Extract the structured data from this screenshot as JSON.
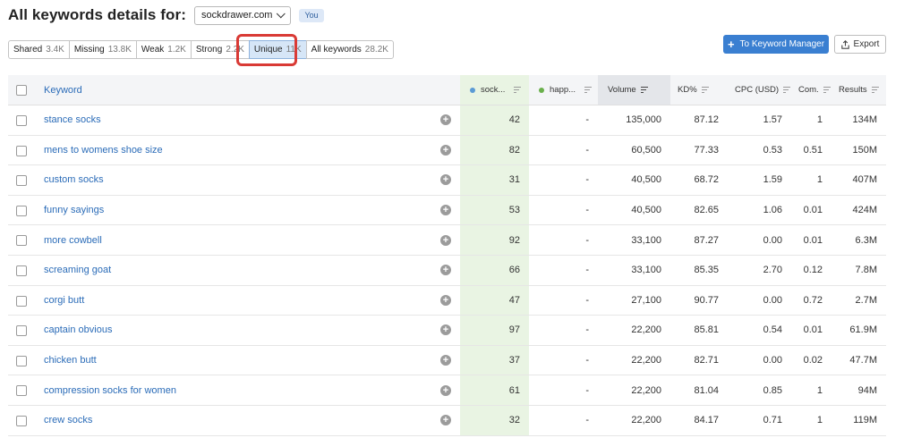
{
  "header": {
    "title": "All keywords details for:",
    "domain": "sockdrawer.com",
    "badge": "You"
  },
  "filters": [
    {
      "label": "Shared",
      "count": "3.4K",
      "active": false
    },
    {
      "label": "Missing",
      "count": "13.8K",
      "active": false
    },
    {
      "label": "Weak",
      "count": "1.2K",
      "active": false
    },
    {
      "label": "Strong",
      "count": "2.2K",
      "active": false
    },
    {
      "label": "Unique",
      "count": "11K",
      "active": true
    },
    {
      "label": "All keywords",
      "count": "28.2K",
      "active": false
    }
  ],
  "toolbar": {
    "to_keyword_manager": "To Keyword Manager",
    "export": "Export"
  },
  "colors": {
    "accent": "#3a7fd1",
    "sock_dot": "#5b9bd5",
    "happ_dot": "#6ab04c",
    "highlight": "#d93a35"
  },
  "table": {
    "columns": {
      "keyword": "Keyword",
      "sock": "sock...",
      "happ": "happ...",
      "volume": "Volume",
      "kd": "KD%",
      "cpc": "CPC (USD)",
      "com": "Com.",
      "results": "Results"
    },
    "rows": [
      {
        "keyword": "stance socks",
        "sock": "42",
        "happ": "-",
        "volume": "135,000",
        "kd": "87.12",
        "cpc": "1.57",
        "com": "1",
        "results": "134M"
      },
      {
        "keyword": "mens to womens shoe size",
        "sock": "82",
        "happ": "-",
        "volume": "60,500",
        "kd": "77.33",
        "cpc": "0.53",
        "com": "0.51",
        "results": "150M"
      },
      {
        "keyword": "custom socks",
        "sock": "31",
        "happ": "-",
        "volume": "40,500",
        "kd": "68.72",
        "cpc": "1.59",
        "com": "1",
        "results": "407M"
      },
      {
        "keyword": "funny sayings",
        "sock": "53",
        "happ": "-",
        "volume": "40,500",
        "kd": "82.65",
        "cpc": "1.06",
        "com": "0.01",
        "results": "424M"
      },
      {
        "keyword": "more cowbell",
        "sock": "92",
        "happ": "-",
        "volume": "33,100",
        "kd": "87.27",
        "cpc": "0.00",
        "com": "0.01",
        "results": "6.3M"
      },
      {
        "keyword": "screaming goat",
        "sock": "66",
        "happ": "-",
        "volume": "33,100",
        "kd": "85.35",
        "cpc": "2.70",
        "com": "0.12",
        "results": "7.8M"
      },
      {
        "keyword": "corgi butt",
        "sock": "47",
        "happ": "-",
        "volume": "27,100",
        "kd": "90.77",
        "cpc": "0.00",
        "com": "0.72",
        "results": "2.7M"
      },
      {
        "keyword": "captain obvious",
        "sock": "97",
        "happ": "-",
        "volume": "22,200",
        "kd": "85.81",
        "cpc": "0.54",
        "com": "0.01",
        "results": "61.9M"
      },
      {
        "keyword": "chicken butt",
        "sock": "37",
        "happ": "-",
        "volume": "22,200",
        "kd": "82.71",
        "cpc": "0.00",
        "com": "0.02",
        "results": "47.7M"
      },
      {
        "keyword": "compression socks for women",
        "sock": "61",
        "happ": "-",
        "volume": "22,200",
        "kd": "81.04",
        "cpc": "0.85",
        "com": "1",
        "results": "94M"
      },
      {
        "keyword": "crew socks",
        "sock": "32",
        "happ": "-",
        "volume": "22,200",
        "kd": "84.17",
        "cpc": "0.71",
        "com": "1",
        "results": "119M"
      }
    ]
  }
}
